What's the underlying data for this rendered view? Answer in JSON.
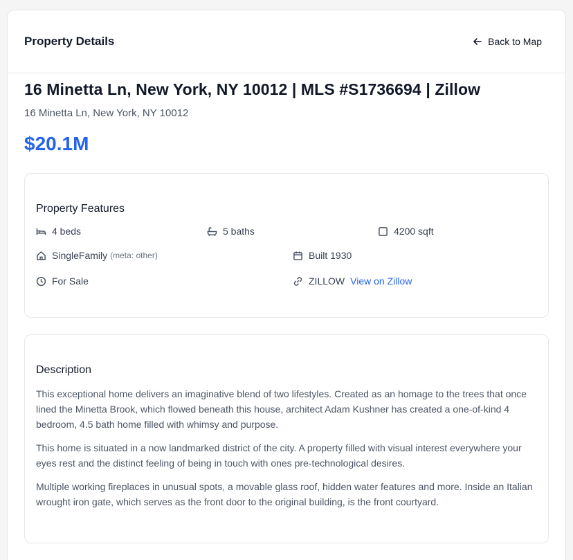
{
  "header": {
    "title": "Property Details",
    "back_label": "Back to Map"
  },
  "listing": {
    "title": "16 Minetta Ln, New York, NY 10012 | MLS #S1736694 | Zillow",
    "address": "16 Minetta Ln, New York, NY 10012",
    "price": "$20.1M"
  },
  "features": {
    "heading": "Property Features",
    "beds": "4 beds",
    "baths": "5 baths",
    "sqft": "4200 sqft",
    "type": "SingleFamily",
    "type_meta": "(meta: other)",
    "built": "Built 1930",
    "status": "For Sale",
    "source": "ZILLOW",
    "source_link": "View on Zillow"
  },
  "description": {
    "heading": "Description",
    "paragraphs": [
      "This exceptional home delivers an imaginative blend of two lifestyles. Created as an homage to the trees that once lined the Minetta Brook, which flowed beneath this house, architect Adam Kushner has created a one-of-kind 4 bedroom, 4.5 bath home filled with whimsy and purpose.",
      "This home is situated in a now landmarked district of the city. A property filled with visual interest everywhere your eyes rest and the distinct feeling of being in touch with ones pre-technological desires.",
      "Multiple working fireplaces in unusual spots, a movable glass roof, hidden water features and more. Inside an Italian wrought iron gate, which serves as the front door to the original building, is the front courtyard."
    ]
  },
  "colors": {
    "accent": "#2563eb",
    "text": "#111827",
    "muted": "#4b5563"
  }
}
